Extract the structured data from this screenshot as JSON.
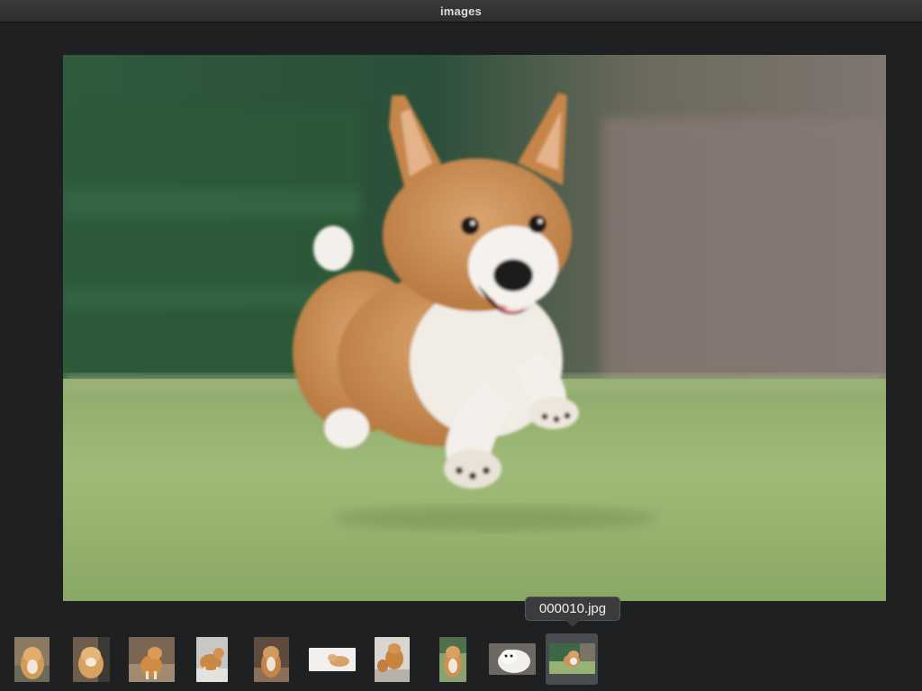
{
  "window": {
    "title": "images"
  },
  "viewer": {
    "image_icon": "corgi-running-photo"
  },
  "filmstrip": {
    "selected_index": 9,
    "tooltip": "000010.jpg",
    "thumbs": [
      {
        "icon": "shiba-sitting-photo"
      },
      {
        "icon": "shiba-puppy-photo"
      },
      {
        "icon": "shiba-on-dirt-photo"
      },
      {
        "icon": "shiba-in-snow-photo"
      },
      {
        "icon": "shiba-standing-photo"
      },
      {
        "icon": "dog-on-white-photo"
      },
      {
        "icon": "shiba-pair-photo"
      },
      {
        "icon": "shiba-portrait-photo"
      },
      {
        "icon": "white-dog-photo"
      },
      {
        "icon": "corgi-running-photo"
      }
    ]
  }
}
